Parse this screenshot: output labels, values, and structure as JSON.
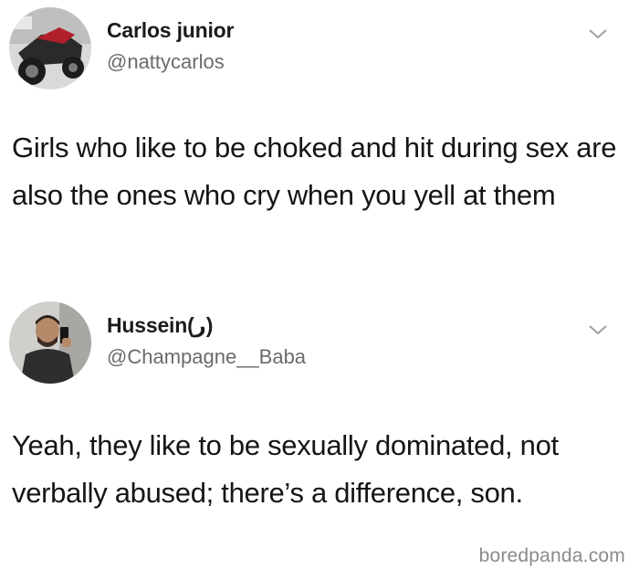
{
  "tweets": [
    {
      "display_name": "Carlos junior",
      "handle": "@nattycarlos",
      "text": "Girls who like to be choked and hit during sex are also the ones who cry when you yell at them",
      "menu_icon": "chevron-down-icon"
    },
    {
      "display_name": "Hussein(ر)",
      "handle": "@Champagne__Baba",
      "text": "Yeah, they like to be sexually dominated, not verbally abused; there’s a difference, son.",
      "menu_icon": "chevron-down-icon"
    }
  ],
  "watermark": "boredpanda.com"
}
